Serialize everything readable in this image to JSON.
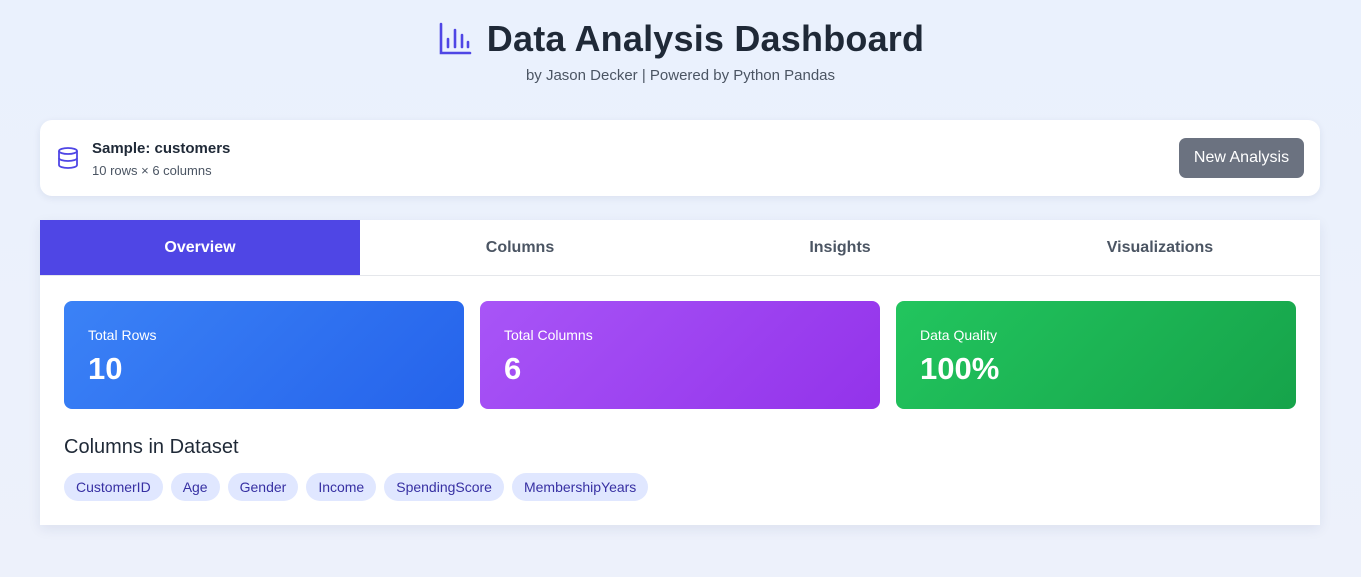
{
  "header": {
    "title": "Data Analysis Dashboard",
    "subtitle": "by Jason Decker | Powered by Python Pandas",
    "icon": "bar-chart-icon"
  },
  "sample": {
    "name": "Sample: customers",
    "meta": "10 rows × 6 columns",
    "icon": "database-icon",
    "new_button": "New Analysis"
  },
  "tabs": [
    {
      "label": "Overview",
      "active": true
    },
    {
      "label": "Columns",
      "active": false
    },
    {
      "label": "Insights",
      "active": false
    },
    {
      "label": "Visualizations",
      "active": false
    }
  ],
  "stats": [
    {
      "label": "Total Rows",
      "value": "10",
      "color": "#2563eb"
    },
    {
      "label": "Total Columns",
      "value": "6",
      "color": "#9333ea"
    },
    {
      "label": "Data Quality",
      "value": "100%",
      "color": "#16a34a"
    }
  ],
  "columns_section": {
    "heading": "Columns in Dataset",
    "items": [
      "CustomerID",
      "Age",
      "Gender",
      "Income",
      "SpendingScore",
      "MembershipYears"
    ]
  },
  "colors": {
    "accent": "#4f46e5",
    "button_gray": "#6b7280",
    "chip_bg": "#e0e7ff",
    "chip_text": "#3730a3"
  }
}
